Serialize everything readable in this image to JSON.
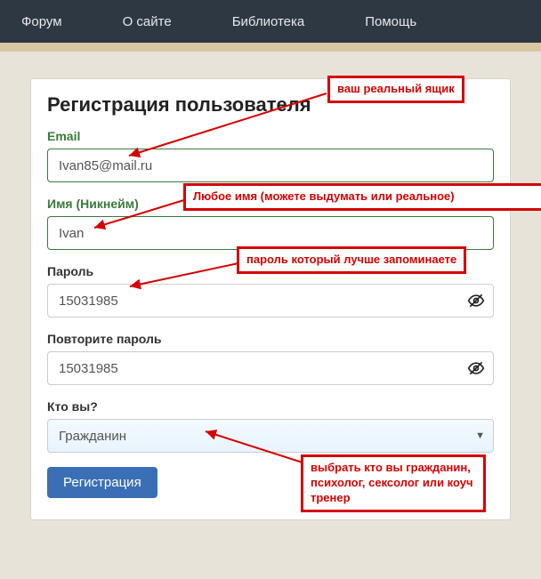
{
  "nav": {
    "items": [
      "Форум",
      "О сайте",
      "Библиотека",
      "Помощь"
    ]
  },
  "form": {
    "title": "Регистрация пользователя",
    "email_label": "Email",
    "email_value": "Ivan85@mail.ru",
    "name_label": "Имя (Никнейм)",
    "name_value": "Ivan",
    "password_label": "Пароль",
    "password_value": "15031985",
    "repeat_label": "Повторите пароль",
    "repeat_value": "15031985",
    "who_label": "Кто вы?",
    "who_value": "Гражданин",
    "submit_label": "Регистрация"
  },
  "annotations": {
    "a1": "ваш реальный ящик",
    "a2": "Любое имя (можете выдумать или реальное)",
    "a3": "пароль который лучше запоминаете",
    "a4": "выбрать кто вы гражданин, психолог, сексолог или коуч тренер"
  }
}
